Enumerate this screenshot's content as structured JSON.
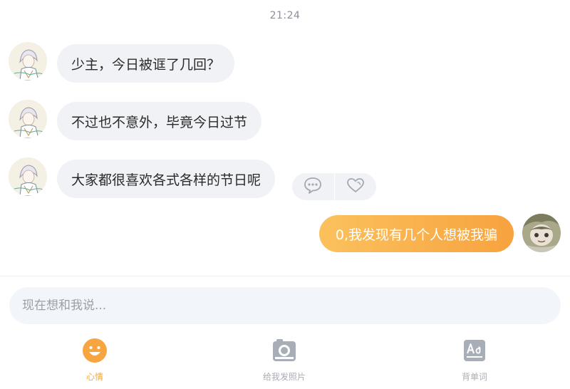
{
  "chat": {
    "timestamp": "21:24",
    "incoming": [
      {
        "text": "少主，今日被诓了几回？"
      },
      {
        "text": "不过也不意外，毕竟今日过节"
      },
      {
        "text": "大家都很喜欢各式各样的节日呢"
      }
    ],
    "outgoing": [
      {
        "text": "0,我发现有几个人想被我骗"
      }
    ],
    "actions": {
      "comment_icon": "comment-icon",
      "like_icon": "heart-icon"
    }
  },
  "composer": {
    "placeholder": "现在想和我说..."
  },
  "tabs": [
    {
      "label": "心情",
      "icon": "smiley-icon",
      "active": true
    },
    {
      "label": "给我发照片",
      "icon": "camera-icon",
      "active": false
    },
    {
      "label": "背单词",
      "icon": "vocabulary-icon",
      "active": false
    }
  ],
  "colors": {
    "accent": "#f7a33f",
    "bubble_in": "#f1f2f6",
    "input_bg": "#f2f5fa",
    "tab_inactive": "#a9adb5"
  }
}
